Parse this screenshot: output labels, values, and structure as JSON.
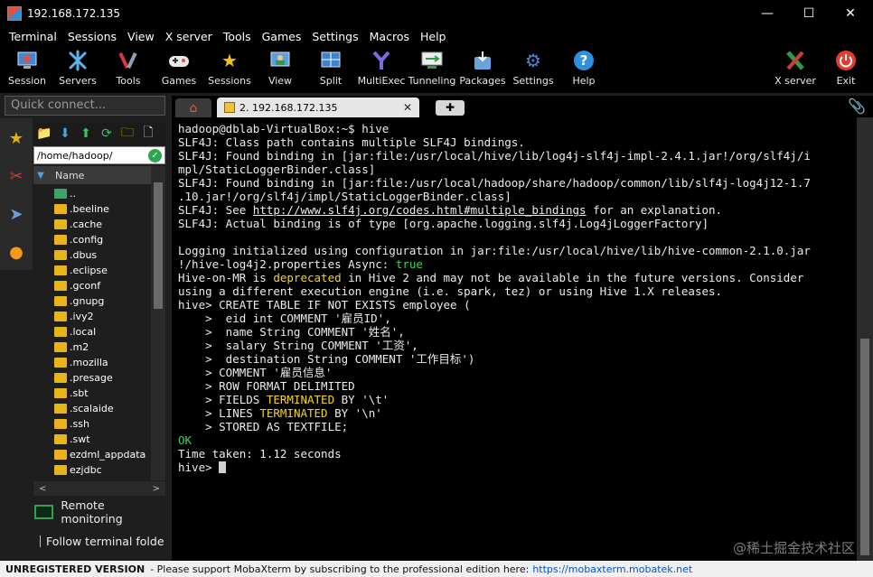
{
  "window": {
    "title": "192.168.172.135",
    "controls": {
      "minimize": "—",
      "maximize": "☐",
      "close": "✕"
    }
  },
  "menu": [
    "Terminal",
    "Sessions",
    "View",
    "X server",
    "Tools",
    "Games",
    "Settings",
    "Macros",
    "Help"
  ],
  "toolbar": {
    "items": [
      {
        "label": "Session",
        "icon": "session-icon"
      },
      {
        "label": "Servers",
        "icon": "servers-icon"
      },
      {
        "label": "Tools",
        "icon": "tools-icon"
      },
      {
        "label": "Games",
        "icon": "games-icon"
      },
      {
        "label": "Sessions",
        "icon": "sessions-star-icon"
      },
      {
        "label": "View",
        "icon": "view-icon"
      },
      {
        "label": "Split",
        "icon": "split-icon"
      },
      {
        "label": "MultiExec",
        "icon": "multiexec-icon"
      },
      {
        "label": "Tunneling",
        "icon": "tunneling-icon"
      },
      {
        "label": "Packages",
        "icon": "packages-icon"
      },
      {
        "label": "Settings",
        "icon": "settings-gears-icon"
      },
      {
        "label": "Help",
        "icon": "help-icon"
      }
    ],
    "right_items": [
      {
        "label": "X server",
        "icon": "x-server-icon"
      },
      {
        "label": "Exit",
        "icon": "power-icon"
      }
    ]
  },
  "sidebar": {
    "quick_connect_placeholder": "Quick connect...",
    "path": "/home/hadoop/",
    "column_header": "Name",
    "files": [
      "..",
      ".beeline",
      ".cache",
      ".config",
      ".dbus",
      ".eclipse",
      ".gconf",
      ".gnupg",
      ".ivy2",
      ".local",
      ".m2",
      ".mozilla",
      ".presage",
      ".sbt",
      ".scalaide",
      ".ssh",
      ".swt",
      "ezdml_appdata",
      "ezjdbc"
    ],
    "remote_monitoring": "Remote monitoring",
    "follow_folder": "Follow terminal folde"
  },
  "tabs": {
    "session_tab_label": "2. 192.168.172.135"
  },
  "terminal": {
    "lines": [
      [
        {
          "t": "hadoop@dblab-VirtualBox:~$ hive"
        }
      ],
      [
        {
          "t": "SLF4J: Class path contains multiple SLF4J bindings."
        }
      ],
      [
        {
          "t": "SLF4J: Found binding in [jar:file:/usr/local/hive/lib/log4j-slf4j-impl-2.4.1.jar!/org/slf4j/i"
        }
      ],
      [
        {
          "t": "mpl/StaticLoggerBinder.class]"
        }
      ],
      [
        {
          "t": "SLF4J: Found binding in [jar:file:/usr/local/hadoop/share/hadoop/common/lib/slf4j-log4j12-1.7"
        }
      ],
      [
        {
          "t": ".10.jar!/org/slf4j/impl/StaticLoggerBinder.class]"
        }
      ],
      [
        {
          "t": "SLF4J: See "
        },
        {
          "t": "http://www.slf4j.org/codes.html#multiple_bindings",
          "c": "url"
        },
        {
          "t": " for an explanation."
        }
      ],
      [
        {
          "t": "SLF4J: Actual binding is of type [org.apache.logging.slf4j.Log4jLoggerFactory]"
        }
      ],
      [
        {
          "t": ""
        }
      ],
      [
        {
          "t": "Logging initialized using configuration in jar:file:/usr/local/hive/lib/hive-common-2.1.0.jar"
        }
      ],
      [
        {
          "t": "!/hive-log4j2.properties Async: "
        },
        {
          "t": "true",
          "c": "hl-g"
        }
      ],
      [
        {
          "t": "Hive-on-MR is "
        },
        {
          "t": "deprecated",
          "c": "hl-y"
        },
        {
          "t": " in Hive 2 and may not be available in the future versions. Consider"
        }
      ],
      [
        {
          "t": "using a different execution engine (i.e. spark, tez) or using Hive 1.X releases."
        }
      ],
      [
        {
          "t": "hive> CREATE TABLE IF NOT EXISTS employee ("
        }
      ],
      [
        {
          "t": "    >  eid int COMMENT '雇员ID',"
        }
      ],
      [
        {
          "t": "    >  name String COMMENT '姓名',"
        }
      ],
      [
        {
          "t": "    >  salary String COMMENT '工资',"
        }
      ],
      [
        {
          "t": "    >  destination String COMMENT '工作目标')"
        }
      ],
      [
        {
          "t": "    > COMMENT '雇员信息'"
        }
      ],
      [
        {
          "t": "    > ROW FORMAT DELIMITED"
        }
      ],
      [
        {
          "t": "    > FIELDS "
        },
        {
          "t": "TERMINATED",
          "c": "hl-y"
        },
        {
          "t": " BY '\\t'"
        }
      ],
      [
        {
          "t": "    > LINES "
        },
        {
          "t": "TERMINATED",
          "c": "hl-y"
        },
        {
          "t": " BY '\\n'"
        }
      ],
      [
        {
          "t": "    > STORED AS TEXTFILE;"
        }
      ],
      [
        {
          "t": "OK",
          "c": "hl-g"
        }
      ],
      [
        {
          "t": "Time taken: 1.12 seconds"
        }
      ],
      [
        {
          "t": "hive> "
        }
      ]
    ]
  },
  "watermark": "@稀土掘金技术社区",
  "statusbar": {
    "unregistered": "UNREGISTERED VERSION",
    "message": "-  Please support MobaXterm by subscribing to the professional edition here:",
    "link": "https://mobaxterm.mobatek.net"
  },
  "colors": {
    "terminal_bg": "#000000",
    "highlight_yellow": "#f7d618",
    "highlight_green": "#3fd35a",
    "folder": "#e8b31c"
  }
}
